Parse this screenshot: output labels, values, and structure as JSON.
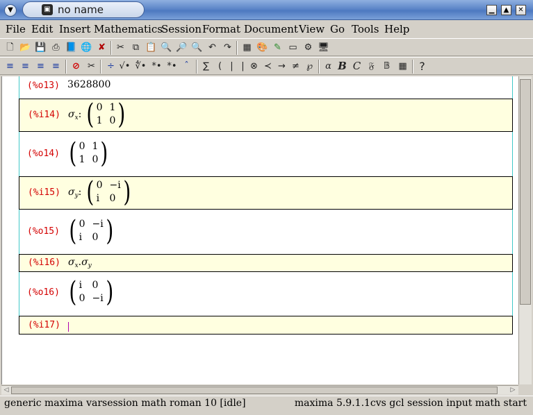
{
  "window": {
    "title": "no name"
  },
  "menu": [
    "File",
    "Edit",
    "Insert",
    "Mathematics",
    "Session",
    "Format",
    "Document",
    "View",
    "Go",
    "Tools",
    "Help"
  ],
  "toolbar2_glyphs": {
    "div": "÷",
    "sqrt": "√•",
    "nthroot": "∜•",
    "sub": "*•",
    "sup": "*•",
    "hat": "ˆ",
    "sum": "∑",
    "lparen": "(",
    "bar1": "|",
    "bar2": "|",
    "otimes": "⊗",
    "prec": "≺",
    "arrow": "→",
    "neq": "≠",
    "wp": "℘",
    "alpha": "α",
    "bold_b": "B",
    "cal_c": "C",
    "frak_f": "𝔉",
    "bb_b": "𝔹",
    "help": "?"
  },
  "cells": [
    {
      "label": "(%o13)",
      "text": "3628800"
    },
    {
      "label": "(%i14)",
      "sigma_sub": "x",
      "matrix": [
        "0",
        "1",
        "1",
        "0"
      ]
    },
    {
      "label": "(%o14)",
      "matrix": [
        "0",
        "1",
        "1",
        "0"
      ]
    },
    {
      "label": "(%i15)",
      "sigma_sub": "y",
      "matrix": [
        "0",
        "−i",
        "i",
        "0"
      ]
    },
    {
      "label": "(%o15)",
      "matrix": [
        "0",
        "−i",
        "i",
        "0"
      ]
    },
    {
      "label": "(%i16)",
      "sigma_sub_a": "x",
      "sigma_sub_b": "y"
    },
    {
      "label": "(%o16)",
      "matrix": [
        "i",
        "0",
        "0",
        "−i"
      ]
    },
    {
      "label": "(%i17)"
    }
  ],
  "math": {
    "sigma": "σ",
    "colon": ":",
    "dot": "."
  },
  "status": {
    "left": "generic maxima varsession math roman 10 [idle]",
    "right": "maxima 5.9.1.1cvs gcl session input math start"
  }
}
